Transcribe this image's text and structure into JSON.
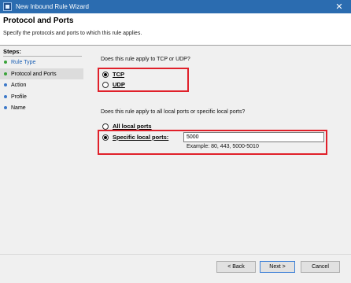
{
  "window": {
    "title": "New Inbound Rule Wizard",
    "close_glyph": "✕"
  },
  "header": {
    "title": "Protocol and Ports",
    "subtitle": "Specify the protocols and ports to which this rule applies."
  },
  "steps": {
    "label": "Steps:",
    "items": [
      {
        "label": "Rule Type",
        "state": "done"
      },
      {
        "label": "Protocol and Ports",
        "state": "current"
      },
      {
        "label": "Action",
        "state": "pending"
      },
      {
        "label": "Profile",
        "state": "pending"
      },
      {
        "label": "Name",
        "state": "pending"
      }
    ]
  },
  "protocol": {
    "question": "Does this rule apply to TCP or UDP?",
    "options": [
      {
        "label": "TCP",
        "selected": true
      },
      {
        "label": "UDP",
        "selected": false
      }
    ]
  },
  "ports": {
    "question": "Does this rule apply to all local ports or specific local ports?",
    "all_label": "All local ports",
    "specific_label": "Specific local ports:",
    "specific_selected": true,
    "value": "5000",
    "example": "Example: 80, 443, 5000-5010"
  },
  "buttons": {
    "back": "< Back",
    "next": "Next >",
    "cancel": "Cancel"
  },
  "colors": {
    "titlebar": "#2b6cb0",
    "highlight_box": "#e0202a",
    "step_done": "#3aa33a",
    "step_pending": "#3c78c8"
  }
}
